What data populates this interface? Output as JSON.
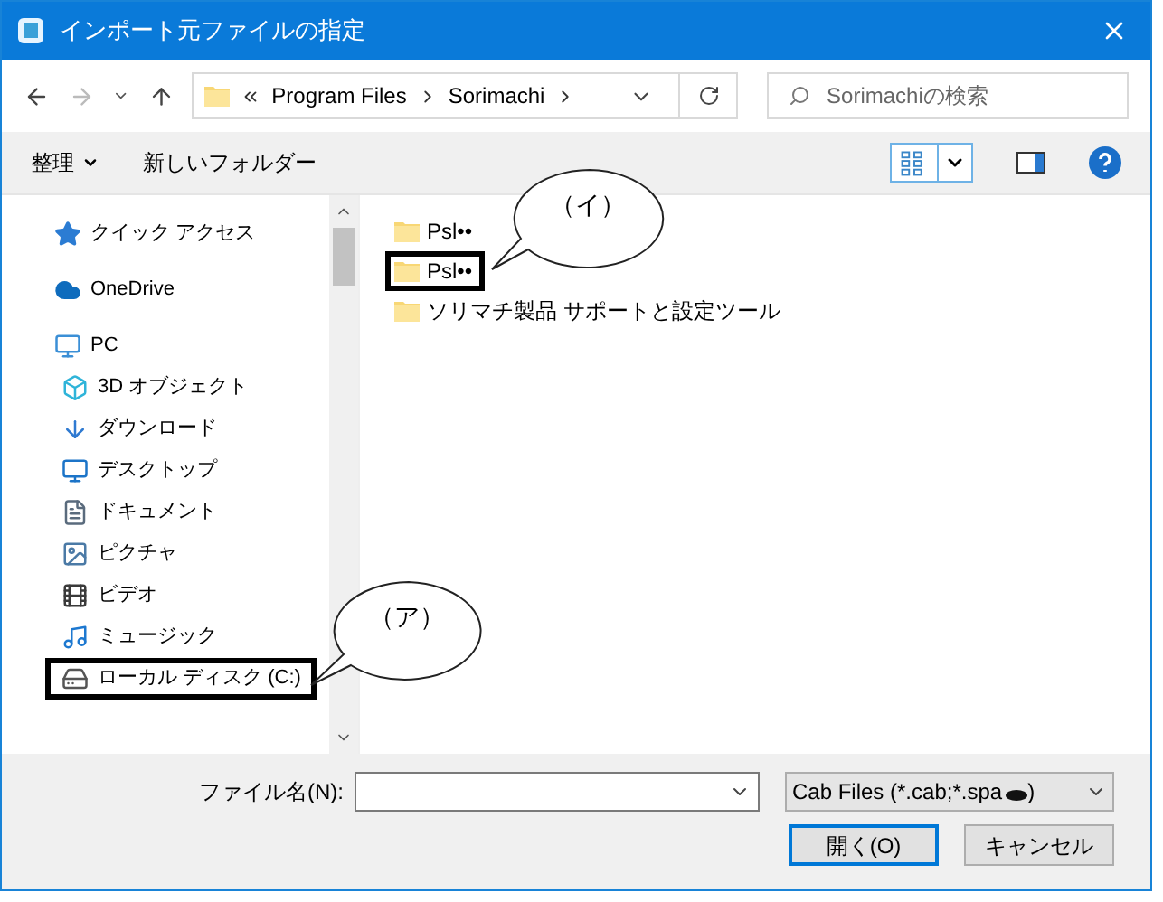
{
  "window": {
    "title": "インポート元ファイルの指定"
  },
  "address": {
    "crumbs": [
      "Program Files",
      "Sorimachi"
    ]
  },
  "search": {
    "placeholder": "Sorimachiの検索"
  },
  "toolbar": {
    "organize": "整理",
    "new_folder": "新しいフォルダー"
  },
  "sidebar": {
    "items": [
      {
        "label": "クイック アクセス",
        "kind": "star",
        "highlighted": false
      },
      {
        "label": "OneDrive",
        "kind": "cloud",
        "highlighted": false
      },
      {
        "label": "PC",
        "kind": "pc",
        "highlighted": false,
        "children": [
          {
            "label": "3D オブジェクト",
            "kind": "cube",
            "highlighted": false
          },
          {
            "label": "ダウンロード",
            "kind": "download",
            "highlighted": false
          },
          {
            "label": "デスクトップ",
            "kind": "desktop",
            "highlighted": false
          },
          {
            "label": "ドキュメント",
            "kind": "document",
            "highlighted": false
          },
          {
            "label": "ピクチャ",
            "kind": "pictures",
            "highlighted": false
          },
          {
            "label": "ビデオ",
            "kind": "video",
            "highlighted": false
          },
          {
            "label": "ミュージック",
            "kind": "music",
            "highlighted": false
          },
          {
            "label": "ローカル ディスク (C:)",
            "kind": "drive",
            "highlighted": true
          }
        ]
      }
    ]
  },
  "files": [
    {
      "name": "Psl••",
      "highlighted": false
    },
    {
      "name": "Psl••",
      "highlighted": true
    },
    {
      "name": "ソリマチ製品 サポートと設定ツール",
      "highlighted": false
    }
  ],
  "callouts": [
    {
      "label": "（イ）"
    },
    {
      "label": "（ア）"
    }
  ],
  "footer": {
    "filename_label": "ファイル名(N):",
    "file_type": "Cab Files (*.cab;*.spa",
    "file_type_end": ")",
    "buttons": [
      {
        "label": "開く(O)",
        "default": true
      },
      {
        "label": "キャンセル",
        "default": false
      }
    ]
  }
}
